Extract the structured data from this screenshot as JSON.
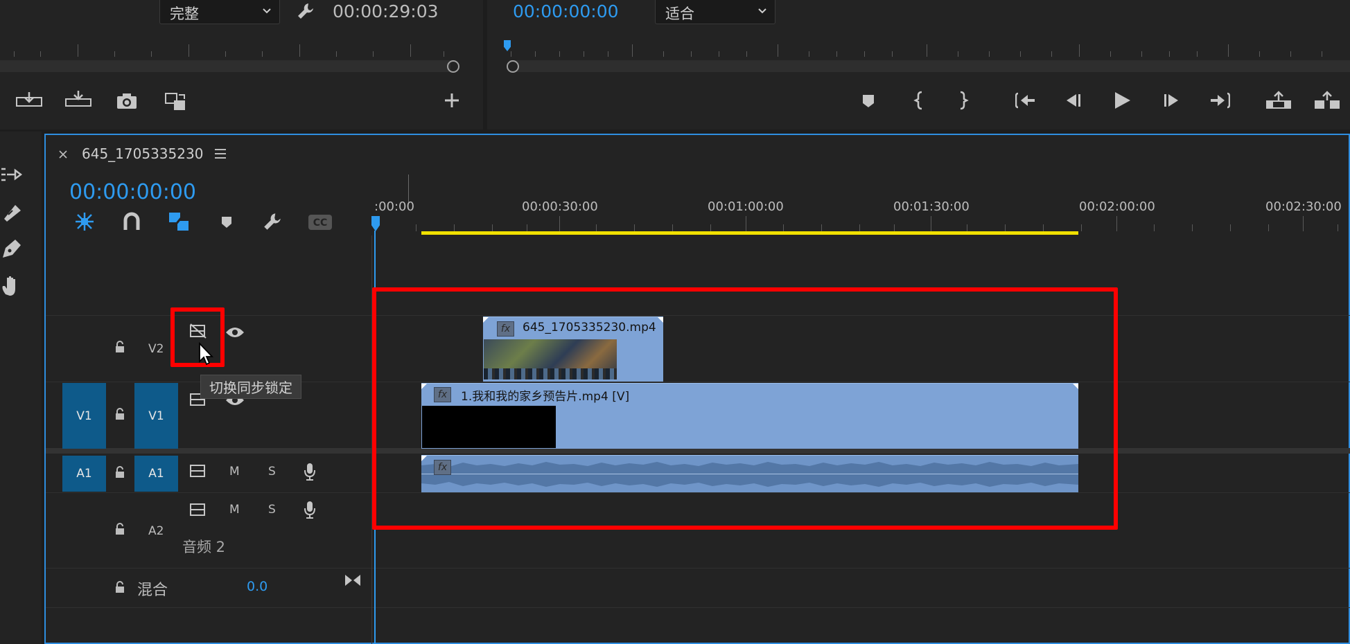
{
  "source_monitor": {
    "quality": "完整",
    "timecode": "00:00:29:03"
  },
  "program_monitor": {
    "timecode": "00:00:00:00",
    "zoom": "适合"
  },
  "timeline": {
    "tab_title": "645_1705335230",
    "timecode": "00:00:00:00",
    "ruler_labels": [
      ":00:00",
      "00:00:30:00",
      "00:01:00:00",
      "00:01:30:00",
      "00:02:00:00",
      "00:02:30:00"
    ]
  },
  "tracks": {
    "v2": {
      "label": "V2"
    },
    "v1": {
      "source": "V1",
      "label": "V1"
    },
    "a1": {
      "source": "A1",
      "label": "A1",
      "mute": "M",
      "solo": "S"
    },
    "a2": {
      "label": "A2",
      "mute": "M",
      "solo": "S",
      "name": "音频 2"
    },
    "mix": {
      "label": "混合",
      "value": "0.0"
    }
  },
  "tooltip": "切换同步锁定",
  "clips": {
    "v2_clip": {
      "name": "645_1705335230.mp4",
      "fx": "fx"
    },
    "v1_clip": {
      "name": "1.我和我的家乡预告片.mp4 [V]",
      "fx": "fx"
    },
    "a1_clip": {
      "fx": "fx"
    }
  },
  "colors": {
    "accent": "#2e9bf0",
    "clip_video": "#7ea3d6",
    "highlight_box": "#ff0000",
    "work_area": "#f0e000"
  }
}
